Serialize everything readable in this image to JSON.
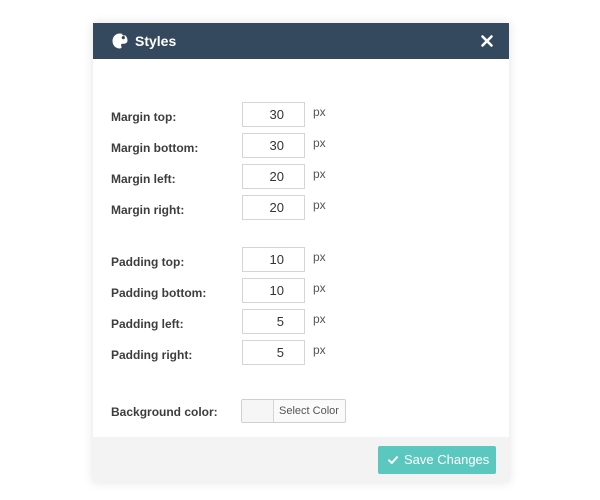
{
  "dialog": {
    "title": "Styles",
    "icon": "palette-icon",
    "close_icon": "close-icon",
    "header_color": "#34495e"
  },
  "margin_fields": [
    {
      "label": "Margin top:",
      "value": "30",
      "unit": "px"
    },
    {
      "label": "Margin bottom:",
      "value": "30",
      "unit": "px"
    },
    {
      "label": "Margin left:",
      "value": "20",
      "unit": "px"
    },
    {
      "label": "Margin right:",
      "value": "20",
      "unit": "px"
    }
  ],
  "padding_fields": [
    {
      "label": "Padding top:",
      "value": "10",
      "unit": "px"
    },
    {
      "label": "Padding bottom:",
      "value": "10",
      "unit": "px"
    },
    {
      "label": "Padding left:",
      "value": "5",
      "unit": "px"
    },
    {
      "label": "Padding right:",
      "value": "5",
      "unit": "px"
    }
  ],
  "background": {
    "label": "Background color:",
    "button_label": "Select Color"
  },
  "footer": {
    "save_label": "Save Changes",
    "save_icon": "check-icon",
    "save_color": "#5bc8c0"
  }
}
